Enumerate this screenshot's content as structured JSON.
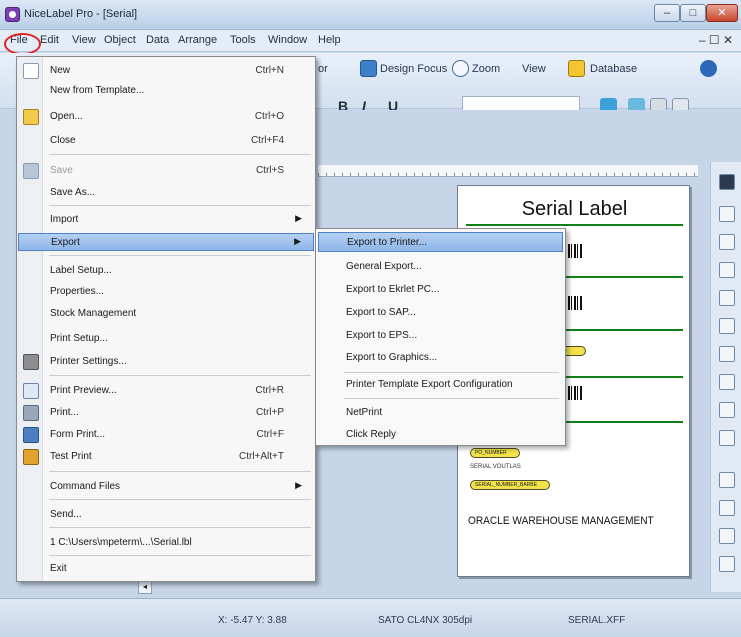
{
  "window": {
    "title": "NiceLabel Pro - [Serial]",
    "minimize_glyph": "–",
    "maximize_glyph": "□",
    "close_glyph": "✕"
  },
  "menubar": {
    "items": [
      "File",
      "Edit",
      "View",
      "Object",
      "Data",
      "Arrange",
      "Tools",
      "Window",
      "Help"
    ],
    "mdi_controls": "– ☐ ✕"
  },
  "toolbar": {
    "design_text": "Design Focus",
    "zoom_text": "Zoom",
    "view_text": "View",
    "database_text": "Database",
    "bold": "B",
    "italic": "I",
    "underline": "U",
    "partial_left": "or",
    "icons": [
      "design-focus-icon",
      "zoom-icon",
      "database-icon",
      "help-icon"
    ]
  },
  "file_menu": {
    "items": [
      {
        "label": "New",
        "shortcut": "Ctrl+N",
        "icon": "new-icon"
      },
      {
        "label": "New from Template...",
        "shortcut": ""
      },
      {
        "label": "Open...",
        "shortcut": "Ctrl+O",
        "icon": "open-folder-icon"
      },
      {
        "label": "Close",
        "shortcut": "Ctrl+F4"
      },
      {
        "label": "Save",
        "shortcut": "Ctrl+S",
        "icon": "save-icon",
        "disabled": true
      },
      {
        "label": "Save As...",
        "shortcut": ""
      },
      {
        "label": "Import",
        "shortcut": "",
        "submenu": true
      },
      {
        "label": "Export",
        "shortcut": "",
        "submenu": true,
        "highlight": true
      },
      {
        "label": "Label Setup...",
        "shortcut": ""
      },
      {
        "label": "Properties...",
        "shortcut": ""
      },
      {
        "label": "Stock Management",
        "shortcut": ""
      },
      {
        "label": "Print Setup...",
        "shortcut": ""
      },
      {
        "label": "Printer Settings...",
        "shortcut": "",
        "icon": "printer-settings-icon"
      },
      {
        "label": "Print Preview...",
        "shortcut": "Ctrl+R",
        "icon": "print-preview-icon"
      },
      {
        "label": "Print...",
        "shortcut": "Ctrl+P",
        "icon": "print-icon"
      },
      {
        "label": "Form Print...",
        "shortcut": "Ctrl+F",
        "icon": "form-print-icon"
      },
      {
        "label": "Test Print",
        "shortcut": "Ctrl+Alt+T",
        "icon": "test-print-icon"
      },
      {
        "label": "Command Files",
        "shortcut": "",
        "submenu": true
      },
      {
        "label": "Send...",
        "shortcut": ""
      },
      {
        "label": "1 C:\\Users\\mpeterm\\...\\Serial.lbl",
        "shortcut": ""
      },
      {
        "label": "Exit",
        "shortcut": ""
      }
    ]
  },
  "export_submenu": {
    "items": [
      {
        "label": "Export to Printer...",
        "highlight": true
      },
      {
        "label": "General Export..."
      },
      {
        "label": "Export to Ekrlet PC..."
      },
      {
        "label": "Export to SAP..."
      },
      {
        "label": "Export to EPS..."
      },
      {
        "label": "Export to Graphics..."
      },
      {
        "label": "Printer Template Export Configuration"
      },
      {
        "label": "NetPrint"
      },
      {
        "label": "Click Reply"
      }
    ]
  },
  "label": {
    "title": "Serial Label",
    "small_text": "SERIAL VOUTLAS",
    "pill_text_1": "PO_NUMBER",
    "pill_text_2": "SERIAL_NUMBER_BARBE",
    "footer": "ORACLE WAREHOUSE MANAGEMENT"
  },
  "statusbar": {
    "coords": "X: -5.47 Y: 3.88",
    "printer": "SATO CL4NX 305dpi",
    "label_name": "SERIAL.XFF"
  },
  "colors": {
    "highlight": "#8eb6e8",
    "annotation_circle": "#e12222",
    "label_rule": "#128019",
    "pill_fill": "#f1e14b"
  }
}
